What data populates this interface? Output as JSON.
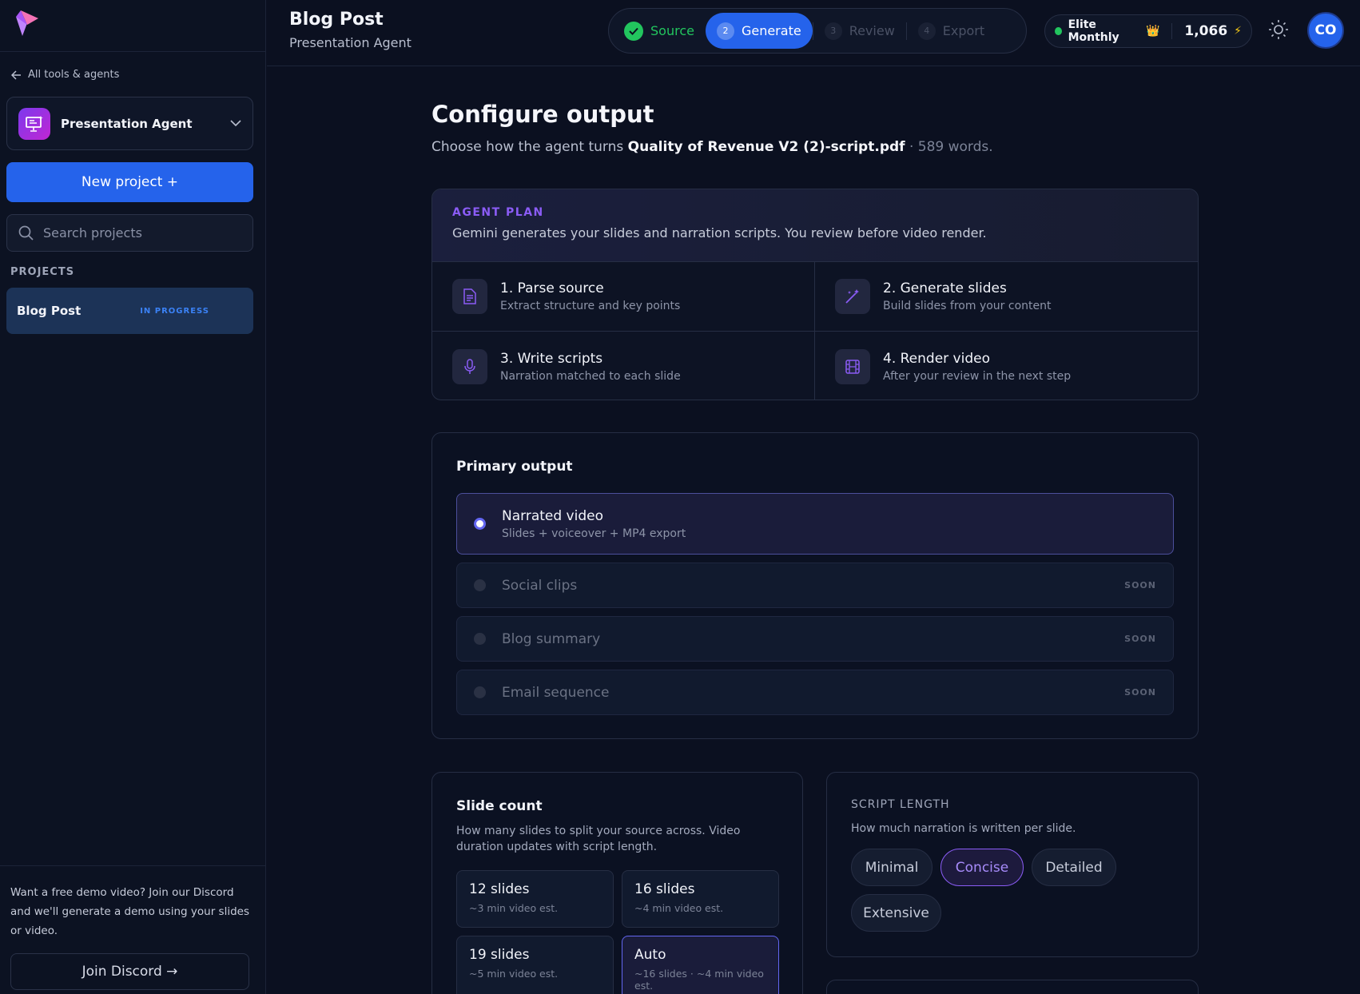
{
  "sidebar": {
    "back_link": "All tools & agents",
    "agent_name": "Presentation Agent",
    "new_project": "New project +",
    "search_placeholder": "Search projects",
    "projects_label": "PROJECTS",
    "projects": [
      {
        "name": "Blog Post",
        "status": "IN PROGRESS"
      }
    ],
    "footer_text": "Want a free demo video? Join our Discord and we'll generate a demo using your slides or video.",
    "discord_button": "Join Discord →"
  },
  "header": {
    "title": "Blog Post",
    "subtitle": "Presentation Agent",
    "steps": [
      {
        "num": "1",
        "label": "Source",
        "state": "done"
      },
      {
        "num": "2",
        "label": "Generate",
        "state": "active"
      },
      {
        "num": "3",
        "label": "Review",
        "state": "pending"
      },
      {
        "num": "4",
        "label": "Export",
        "state": "pending"
      }
    ],
    "plan": "Elite Monthly",
    "plan_emoji": "👑",
    "credits": "1,066",
    "credits_icon": "⚡",
    "avatar_initials": "CO"
  },
  "main": {
    "title": "Configure output",
    "intro_prefix": "Choose how the agent turns",
    "file_name": "Quality of Revenue V2 (2)-script.pdf",
    "intro_sep": "·",
    "word_count": "589 words.",
    "agent_plan": {
      "label": "AGENT PLAN",
      "description": "Gemini generates your slides and narration scripts. You review before video render.",
      "steps": [
        {
          "title": "1. Parse source",
          "subtitle": "Extract structure and key points",
          "icon": "document-icon"
        },
        {
          "title": "2. Generate slides",
          "subtitle": "Build slides from your content",
          "icon": "magic-wand-icon"
        },
        {
          "title": "3. Write scripts",
          "subtitle": "Narration matched to each slide",
          "icon": "microphone-icon"
        },
        {
          "title": "4. Render video",
          "subtitle": "After your review in the next step",
          "icon": "film-icon"
        }
      ]
    },
    "primary_output": {
      "title": "Primary output",
      "options": [
        {
          "title": "Narrated video",
          "subtitle": "Slides + voiceover + MP4 export",
          "selected": true,
          "badge": ""
        },
        {
          "title": "Social clips",
          "subtitle": "",
          "selected": false,
          "badge": "SOON"
        },
        {
          "title": "Blog summary",
          "subtitle": "",
          "selected": false,
          "badge": "SOON"
        },
        {
          "title": "Email sequence",
          "subtitle": "",
          "selected": false,
          "badge": "SOON"
        }
      ]
    },
    "slide_count": {
      "title": "Slide count",
      "description": "How many slides to split your source across. Video duration updates with script length.",
      "options": [
        {
          "title": "12 slides",
          "subtitle": "~3 min video est."
        },
        {
          "title": "16 slides",
          "subtitle": "~4 min video est."
        },
        {
          "title": "19 slides",
          "subtitle": "~5 min video est."
        },
        {
          "title": "Auto",
          "subtitle": "~16 slides · ~4 min video est."
        }
      ],
      "selected_index": 3
    },
    "script_length": {
      "label": "SCRIPT LENGTH",
      "description": "How much narration is written per slide.",
      "options": [
        "Minimal",
        "Concise",
        "Detailed",
        "Extensive"
      ],
      "selected": "Concise"
    }
  },
  "colors": {
    "accent_blue": "#2563eb",
    "accent_purple": "#8b5cf6",
    "success_green": "#22c55e",
    "background": "#0b1020"
  }
}
